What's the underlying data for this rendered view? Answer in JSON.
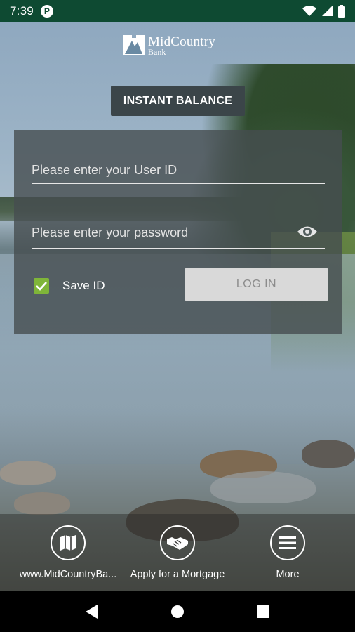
{
  "status_bar": {
    "time": "7:39",
    "app_icon_letter": "P",
    "icons": [
      "wifi-icon",
      "cell-signal-icon",
      "battery-icon"
    ]
  },
  "logo": {
    "name": "MidCountry",
    "sub": "Bank"
  },
  "instant_balance": {
    "label": "INSTANT BALANCE"
  },
  "login": {
    "user_id_placeholder": "Please enter your User ID",
    "password_placeholder": "Please enter your password",
    "save_id_label": "Save ID",
    "save_id_checked": true,
    "login_label": "LOG IN"
  },
  "quick_links": [
    {
      "label": "www.MidCountryBa...",
      "icon": "map-icon"
    },
    {
      "label": "Apply for a Mortgage",
      "icon": "handshake-icon"
    },
    {
      "label": "More",
      "icon": "menu-icon"
    }
  ],
  "colors": {
    "status_bar": "#0e4a32",
    "checkbox": "#7fb539",
    "login_button": "#d9d9d9",
    "panel": "#464e50"
  }
}
